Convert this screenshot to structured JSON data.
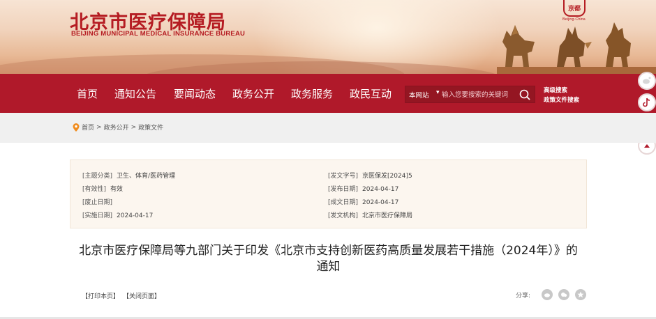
{
  "header": {
    "title_cn": "北京市医疗保障局",
    "title_en": "BEIJING MUNICIPAL MEDICAL INSURANCE BUREAU",
    "seal_text": "京都",
    "seal_caption": "Beijing·China"
  },
  "nav": {
    "items": [
      "首页",
      "通知公告",
      "要闻动态",
      "政务公开",
      "政务服务",
      "政民互动"
    ]
  },
  "search": {
    "scope": "本网站",
    "placeholder": "输入您要搜索的关键词",
    "advanced": "高级搜索",
    "policy": "政策文件搜索"
  },
  "breadcrumb": {
    "items": [
      "首页",
      "政务公开",
      "政策文件"
    ],
    "separator": ">"
  },
  "meta": {
    "left": [
      {
        "label": "[主题分类]",
        "value": "卫生、体育/医药管理"
      },
      {
        "label": "[有效性]",
        "value": "有效"
      },
      {
        "label": "[废止日期]",
        "value": ""
      },
      {
        "label": "[实施日期]",
        "value": "2024-04-17"
      }
    ],
    "right": [
      {
        "label": "[发文字号]",
        "value": "京医保发[2024]5"
      },
      {
        "label": "[发布日期]",
        "value": "2024-04-17"
      },
      {
        "label": "[成文日期]",
        "value": "2024-04-17"
      },
      {
        "label": "[发文机构]",
        "value": "北京市医疗保障局"
      }
    ]
  },
  "document": {
    "title_line1": "北京市医疗保障局等九部门关于印发《北京市支持创新医药高质量发展若干措施（2024年）》的",
    "title_line2": "通知"
  },
  "tools": {
    "print": "【打印本页】",
    "close": "【关闭页面】",
    "share": "分享:"
  },
  "colors": {
    "brand_red": "#b0192a",
    "title_red": "#b51c22",
    "meta_bg": "#fcf6ef"
  }
}
